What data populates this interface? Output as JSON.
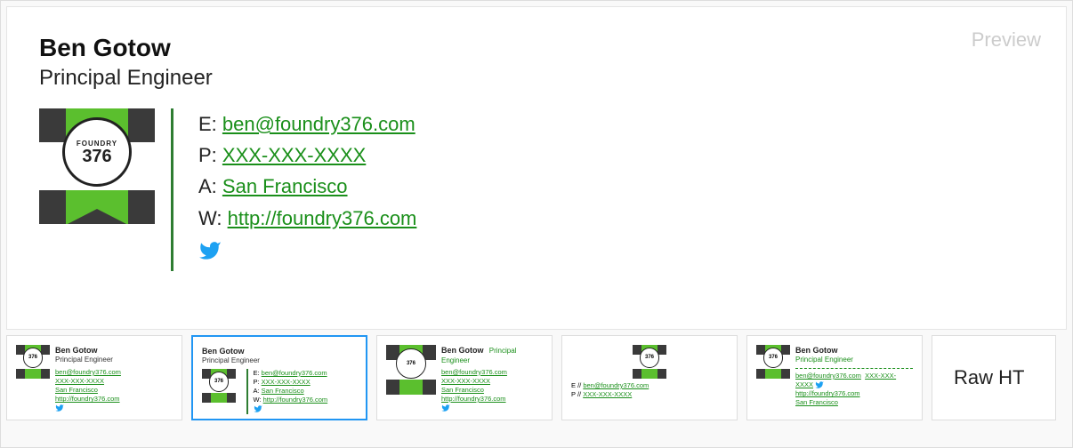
{
  "preview_label": "Preview",
  "signature": {
    "name": "Ben Gotow",
    "title": "Principal Engineer",
    "logo": {
      "line1": "FOUNDRY",
      "line2": "376"
    },
    "email": {
      "prefix": "E: ",
      "value": "ben@foundry376.com"
    },
    "phone": {
      "prefix": "P: ",
      "value": "XXX-XXX-XXXX"
    },
    "address": {
      "prefix": "A: ",
      "value": "San Francisco"
    },
    "website": {
      "prefix": "W: ",
      "value": "http://foundry376.com"
    }
  },
  "thumbnails": {
    "common": {
      "name": "Ben Gotow",
      "title": "Principal Engineer",
      "email": "ben@foundry376.com",
      "phone": "XXX-XXX-XXXX",
      "address": "San Francisco",
      "website": "http://foundry376.com",
      "logo_text": "376"
    },
    "t1": {
      "email_prefix": "E: ",
      "phone_prefix": "P: ",
      "address_prefix": "A: ",
      "website_prefix": "W: "
    },
    "t4": {
      "email_prefix": "E // ",
      "phone_prefix": "P // "
    },
    "raw_label": "Raw HT"
  }
}
